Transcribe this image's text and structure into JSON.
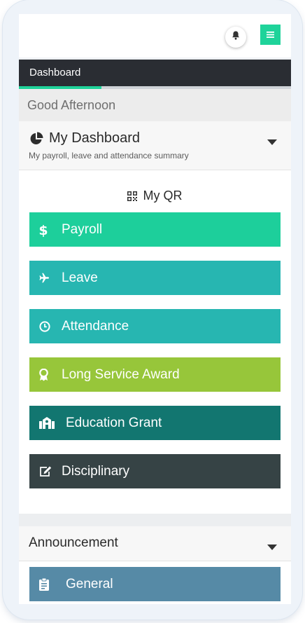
{
  "nav": {
    "active_tab": "Dashboard"
  },
  "greeting": "Good Afternoon",
  "dashboard": {
    "title": "My Dashboard",
    "subtitle": "My payroll, leave and attendance summary",
    "qr_label": "My QR",
    "items": [
      {
        "label": "Payroll",
        "icon": "dollar-icon",
        "color": "#1dcf9b"
      },
      {
        "label": "Leave",
        "icon": "plane-icon",
        "color": "#27b6b1"
      },
      {
        "label": "Attendance",
        "icon": "clock-icon",
        "color": "#27b6b1"
      },
      {
        "label": "Long Service Award",
        "icon": "award-icon",
        "color": "#97c63a"
      },
      {
        "label": "Education Grant",
        "icon": "school-icon",
        "color": "#127670"
      },
      {
        "label": "Disciplinary",
        "icon": "edit-icon",
        "color": "#364345"
      }
    ]
  },
  "announcement": {
    "title": "Announcement",
    "items": [
      {
        "label": "General",
        "icon": "clipboard-icon",
        "color": "#568aa6"
      }
    ]
  },
  "colors": {
    "accent": "#1fd39a",
    "navbar": "#2a2d33"
  }
}
